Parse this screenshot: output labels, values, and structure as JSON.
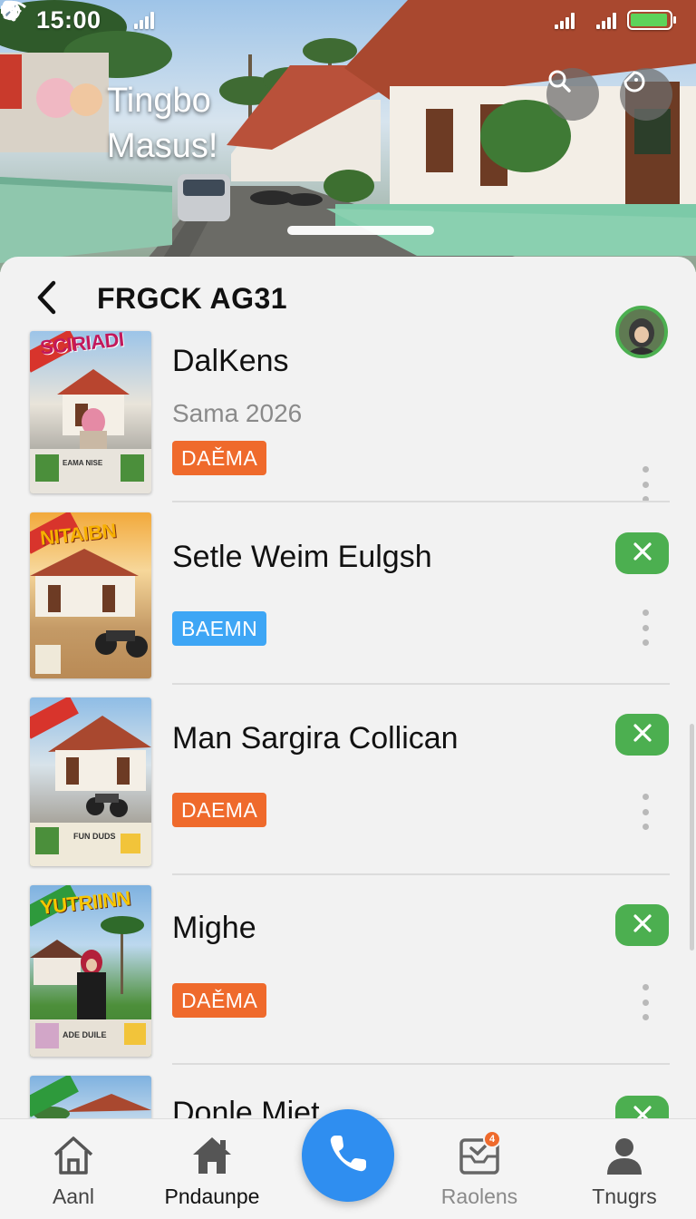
{
  "status_bar": {
    "time": "15:00",
    "left_icons": [
      "sim-card-icon",
      "notification-icon",
      "signal-icon",
      "no-sim-icon"
    ],
    "right_icons": [
      "vibrate-icon",
      "nfc-icon",
      "signal-icon",
      "wifi-icon",
      "signal-icon",
      "battery-icon"
    ],
    "battery_level": 0.95
  },
  "hero": {
    "title": "Tingbo Masus!",
    "search_icon": "search-icon",
    "action_icon": "sticker-icon"
  },
  "sheet": {
    "title": "FRGCK AG31",
    "back_icon": "back-arrow-icon",
    "avatar": "avatar"
  },
  "items": [
    {
      "title": "DalKens",
      "subtitle": "Sama 2026",
      "badge": "DAĚMA",
      "badge_color": "#ef6a2c",
      "poster_title": "SCIRIADI",
      "poster_title_color": "#c2185b",
      "poster_caption": "EAMA NISE",
      "has_close": false
    },
    {
      "title": "Setle Weim Eulgsh",
      "subtitle": "",
      "badge": "BAEMN",
      "badge_color": "#3ea6f5",
      "poster_title": "NITAIBN",
      "poster_title_color": "#f7b000",
      "poster_caption": "",
      "has_close": true
    },
    {
      "title": "Man Sargira Collican",
      "subtitle": "",
      "badge": "DAEMA",
      "badge_color": "#ef6a2c",
      "poster_title": "",
      "poster_title_color": "#ffffff",
      "poster_caption": "FUN DUDS",
      "has_close": true
    },
    {
      "title": "Mighe",
      "subtitle": "",
      "badge": "DAĚMA",
      "badge_color": "#ef6a2c",
      "poster_title": "YUTRIINN",
      "poster_title_color": "#f7c600",
      "poster_caption": "ADE DUILE",
      "has_close": true
    },
    {
      "title": "Donle Miet",
      "subtitle": "",
      "badge": "",
      "badge_color": "#ef6a2c",
      "poster_title": "",
      "poster_title_color": "#ffffff",
      "poster_caption": "",
      "has_close": true
    }
  ],
  "bottom_nav": {
    "items": [
      {
        "label": "Aanl",
        "icon": "home-outline-icon",
        "active": false
      },
      {
        "label": "Pndaunpe",
        "icon": "home-filled-icon",
        "active": true
      },
      {
        "label": "Raolens",
        "icon": "inbox-check-icon",
        "active": false,
        "badge": "4"
      },
      {
        "label": "Tnugrs",
        "icon": "person-icon",
        "active": false
      }
    ],
    "fab_icon": "phone-icon",
    "fab_color": "#2f8ef0"
  },
  "colors": {
    "accent_green": "#4caf50",
    "accent_orange": "#ef6a2c",
    "accent_blue": "#3ea6f5"
  }
}
